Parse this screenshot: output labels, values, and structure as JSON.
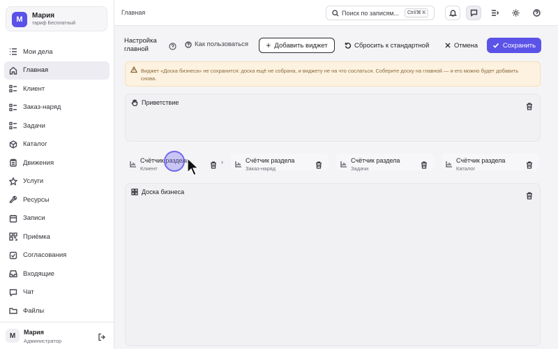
{
  "user": {
    "initial": "М",
    "name": "Мария",
    "plan": "тариф Бесплатный"
  },
  "sidebar": {
    "items": [
      {
        "label": "Мои дела",
        "icon": "list-check-icon"
      },
      {
        "label": "Главная",
        "icon": "home-icon",
        "active": true
      },
      {
        "label": "Клиент",
        "icon": "list-icon"
      },
      {
        "label": "Заказ-наряд",
        "icon": "list-icon"
      },
      {
        "label": "Задачи",
        "icon": "list-icon"
      },
      {
        "label": "Каталог",
        "icon": "box-icon"
      },
      {
        "label": "Движения",
        "icon": "clipboard-icon"
      },
      {
        "label": "Услуги",
        "icon": "star-icon"
      },
      {
        "label": "Ресурсы",
        "icon": "wrench-icon"
      },
      {
        "label": "Записи",
        "icon": "calendar-icon"
      },
      {
        "label": "Приёмка",
        "icon": "qr-icon"
      },
      {
        "label": "Согласования",
        "icon": "approval-icon"
      },
      {
        "label": "Входящие",
        "icon": "inbox-icon"
      },
      {
        "label": "Чат",
        "icon": "chat-icon"
      },
      {
        "label": "Файлы",
        "icon": "folder-icon"
      }
    ]
  },
  "footer": {
    "initial": "М",
    "name": "Мария",
    "role": "Администратор"
  },
  "topbar": {
    "breadcrumb": "Главная",
    "search_placeholder": "Поиск по записям...",
    "search_shortcut": "Ctrl/⌘ K"
  },
  "toolbar": {
    "title": "Настройка главной",
    "how_to": "Как пользоваться",
    "add_widget": "Добавить виджет",
    "reset": "Сбросить к стандартной",
    "cancel": "Отмена",
    "save": "Сохранить"
  },
  "warning": {
    "text": "Виджет «Доска бизнеса» не сохранится: доска ещё не собрана, и виджету не на что сослаться. Соберите доску на главной — и его можно будет добавить снова."
  },
  "widgets": {
    "greeting": "Приветствие",
    "counters": [
      {
        "title": "Счётчик раздела",
        "subtitle": "Клиент"
      },
      {
        "title": "Счётчик раздела",
        "subtitle": "Заказ-наряд"
      },
      {
        "title": "Счётчик раздела",
        "subtitle": "Задачи"
      },
      {
        "title": "Счётчик раздела",
        "subtitle": "Каталог"
      }
    ],
    "board": "Доска бизнеса"
  },
  "colors": {
    "accent": "#5b52e8",
    "warning_bg": "#fdf2e0",
    "warning_text": "#8a6a3a"
  }
}
